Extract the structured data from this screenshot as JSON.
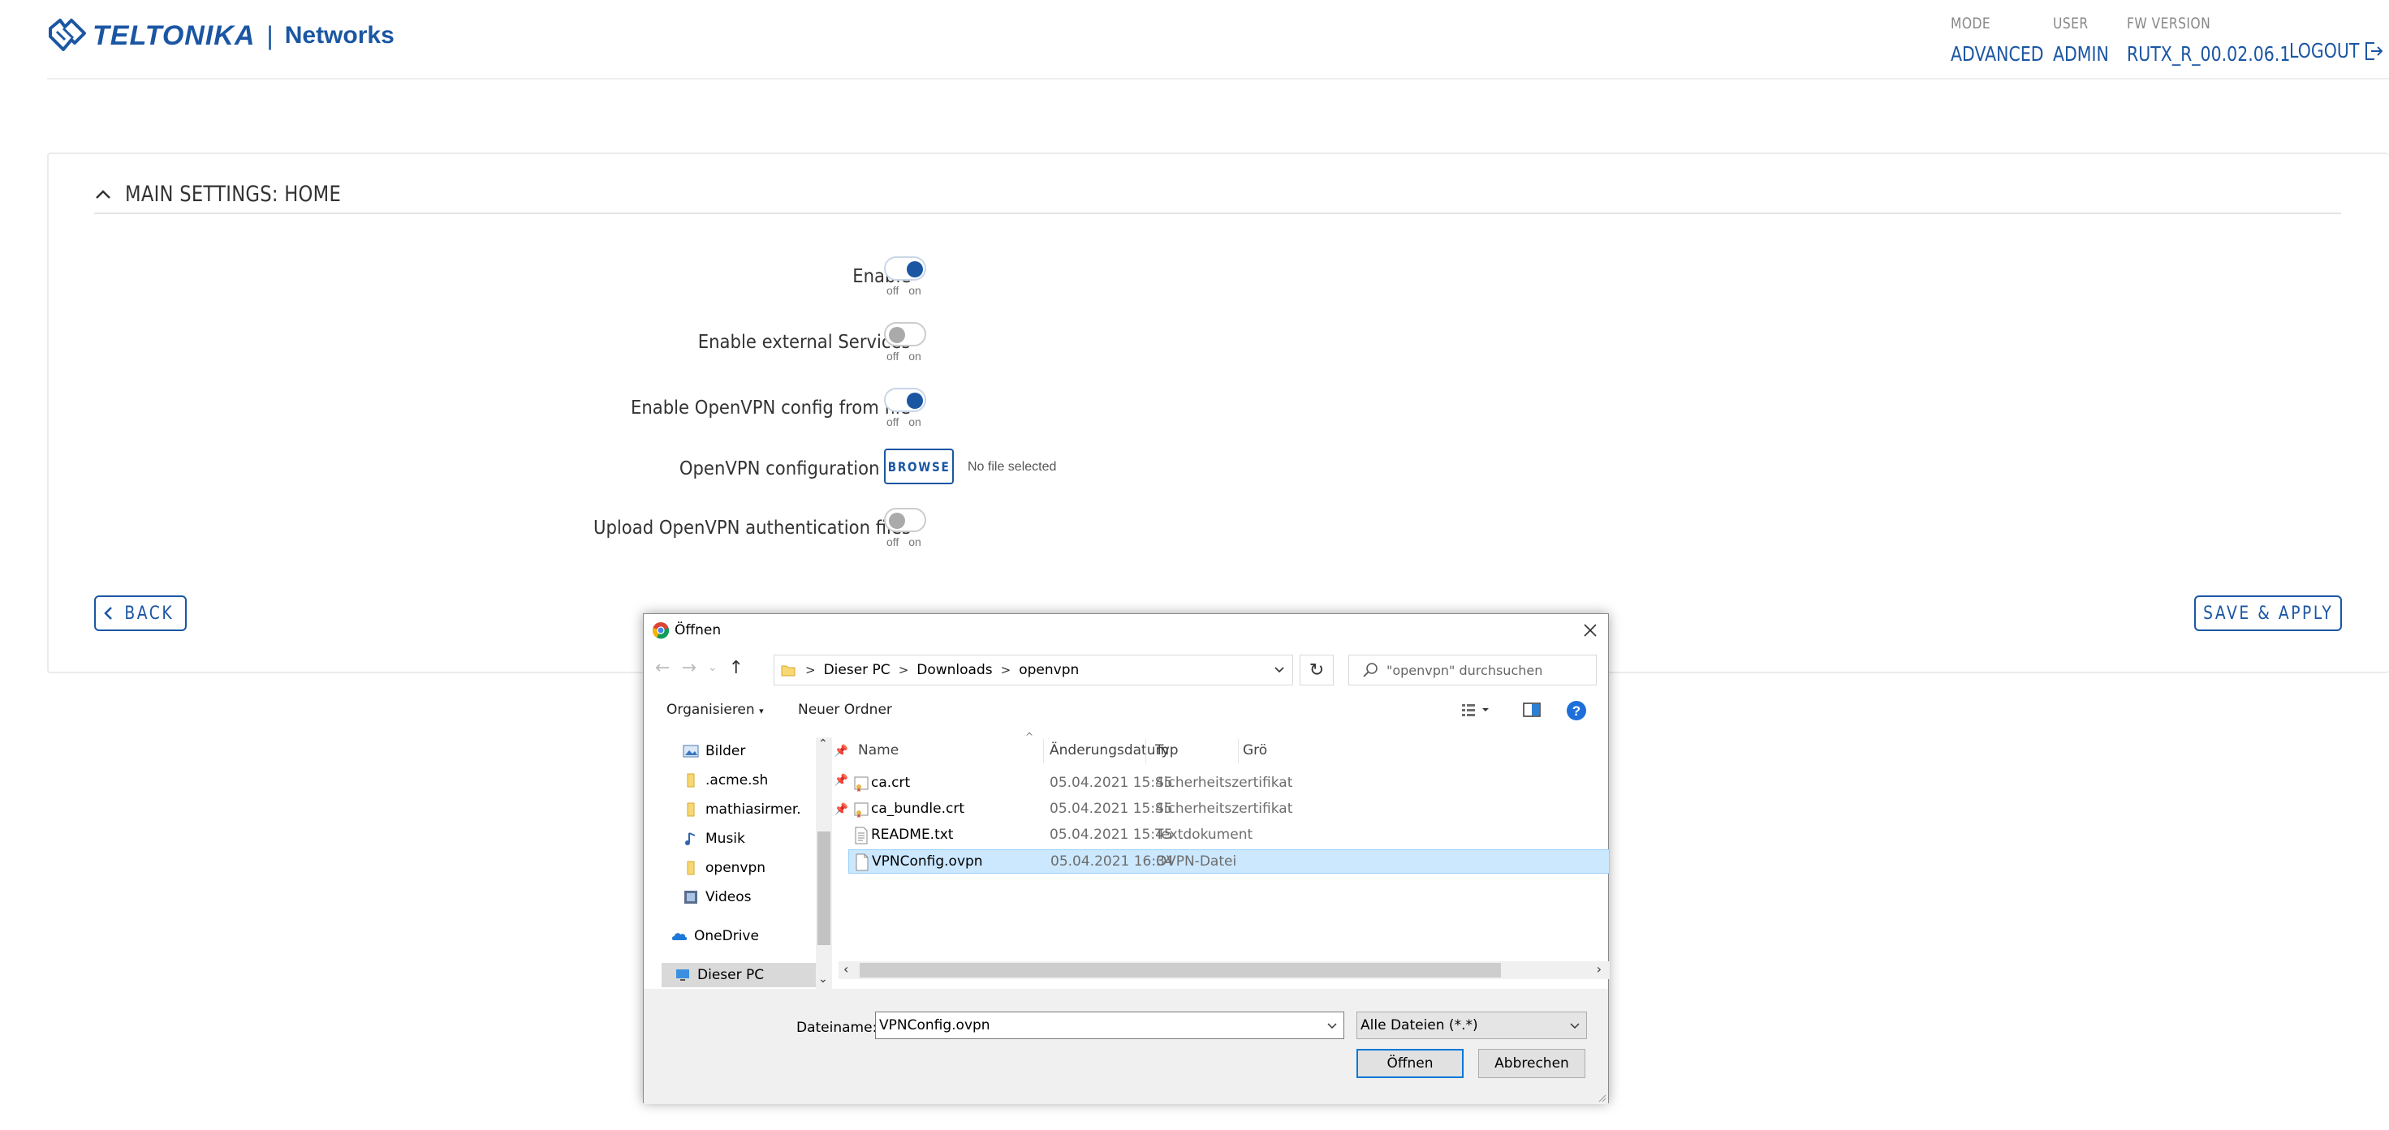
{
  "header": {
    "brand": "TELTONIKA",
    "separator": "|",
    "brand_sub": "Networks",
    "mode": {
      "label": "MODE",
      "value": "ADVANCED"
    },
    "user": {
      "label": "USER",
      "value": "ADMIN"
    },
    "fw": {
      "label": "FW VERSION",
      "value": "RUTX_R_00.02.06.1"
    },
    "logout": "LOGOUT",
    "brand_color": "#1b56a3"
  },
  "section": {
    "title": "MAIN SETTINGS: HOME"
  },
  "form": {
    "off_on": "off on",
    "rows": [
      {
        "label": "Enable",
        "state": "on"
      },
      {
        "label": "Enable external Services",
        "state": "off"
      },
      {
        "label": "Enable OpenVPN config from file",
        "state": "on"
      },
      {
        "label": "OpenVPN configuration file"
      },
      {
        "label": "Upload OpenVPN authentication files",
        "state": "off"
      }
    ],
    "browse_label": "BROWSE",
    "no_file": "No file selected"
  },
  "buttons": {
    "back": "BACK",
    "save": "SAVE & APPLY"
  },
  "dialog": {
    "title": "Öffnen",
    "breadcrumb": [
      "Dieser PC",
      "Downloads",
      "openvpn"
    ],
    "search_placeholder": "\"openvpn\" durchsuchen",
    "toolbar": {
      "organize": "Organisieren",
      "new_folder": "Neuer Ordner",
      "help": "?"
    },
    "nav_items": [
      {
        "label": "Bilder",
        "icon": "pictures-icon",
        "pinned": true
      },
      {
        "label": ".acme.sh",
        "icon": "folder-icon",
        "pinned": true
      },
      {
        "label": "mathiasirmer.",
        "icon": "folder-icon",
        "pinned": true
      },
      {
        "label": "Musik",
        "icon": "music-icon",
        "pinned": false
      },
      {
        "label": "openvpn",
        "icon": "folder-icon",
        "pinned": false
      },
      {
        "label": "Videos",
        "icon": "videos-icon",
        "pinned": false
      },
      {
        "label": "OneDrive",
        "icon": "onedrive-icon",
        "pinned": false
      },
      {
        "label": "Dieser PC",
        "icon": "pc-icon",
        "pinned": false
      }
    ],
    "columns": [
      "Name",
      "Änderungsdatum",
      "Typ",
      "Grö"
    ],
    "files": [
      {
        "name": "ca.crt",
        "date": "05.04.2021 15:45",
        "type": "Sicherheitszertifikat",
        "icon": "certificate-icon"
      },
      {
        "name": "ca_bundle.crt",
        "date": "05.04.2021 15:45",
        "type": "Sicherheitszertifikat",
        "icon": "certificate-icon"
      },
      {
        "name": "README.txt",
        "date": "05.04.2021 15:45",
        "type": "Textdokument",
        "icon": "text-file-icon"
      },
      {
        "name": "VPNConfig.ovpn",
        "date": "05.04.2021 16:34",
        "type": "OVPN-Datei",
        "icon": "file-icon",
        "selected": true
      }
    ],
    "filename_label": "Dateiname:",
    "filename_value": "VPNConfig.ovpn",
    "filter_value": "Alle Dateien (*.*)",
    "open_label": "Öffnen",
    "cancel_label": "Abbrechen",
    "select_color": "#cce8ff"
  }
}
